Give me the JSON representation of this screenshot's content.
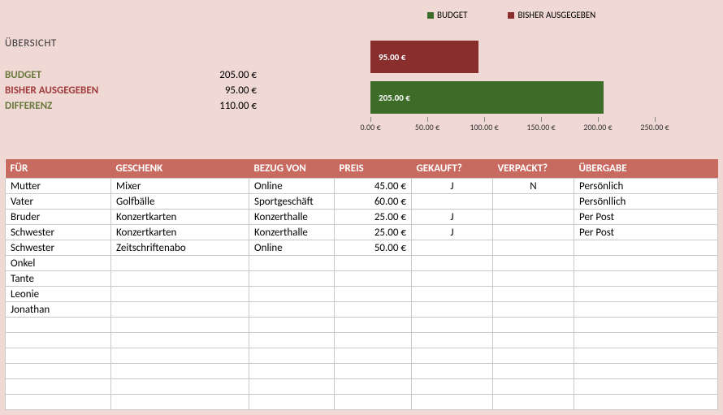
{
  "overview": {
    "title": "ÜBERSICHT",
    "budget_label": "BUDGET",
    "budget_value": "205.00 €",
    "spent_label": "BISHER AUSGEGEBEN",
    "spent_value": "95.00 €",
    "diff_label": "DIFFERENZ",
    "diff_value": "110.00 €"
  },
  "legend": {
    "budget": "BUDGET",
    "spent": "BISHER AUSGEGEBEN"
  },
  "chart_data": {
    "type": "bar",
    "orientation": "horizontal",
    "series": [
      {
        "name": "BISHER AUSGEGEBEN",
        "value": 95.0,
        "label": "95.00 €",
        "color": "#8a2d2d"
      },
      {
        "name": "BUDGET",
        "value": 205.0,
        "label": "205.00 €",
        "color": "#3d6b28"
      }
    ],
    "xlim": [
      0,
      250
    ],
    "xticks": [
      "0.00 €",
      "50.00 €",
      "100.00 €",
      "150.00 €",
      "200.00 €",
      "250.00 €"
    ]
  },
  "table": {
    "headers": {
      "for": "FÜR",
      "gift": "GESCHENK",
      "source": "BEZUG VON",
      "price": "PREIS",
      "bought": "GEKAUFT?",
      "wrapped": "VERPACKT?",
      "delivery": "ÜBERGABE"
    },
    "rows": [
      {
        "for": "Mutter",
        "gift": "Mixer",
        "source": "Online",
        "price": "45.00 €",
        "bought": "J",
        "wrapped": "N",
        "delivery": "Persönlich"
      },
      {
        "for": "Vater",
        "gift": "Golfbälle",
        "source": "Sportgeschäft",
        "price": "60.00 €",
        "bought": "",
        "wrapped": "",
        "delivery": "Persönllich"
      },
      {
        "for": "Bruder",
        "gift": "Konzertkarten",
        "source": "Konzerthalle",
        "price": "25.00 €",
        "bought": "J",
        "wrapped": "",
        "delivery": "Per Post"
      },
      {
        "for": "Schwester",
        "gift": "Konzertkarten",
        "source": "Konzerthalle",
        "price": "25.00 €",
        "bought": "J",
        "wrapped": "",
        "delivery": "Per Post"
      },
      {
        "for": "Schwester",
        "gift": "Zeitschriftenabo",
        "source": "Online",
        "price": "50.00 €",
        "bought": "",
        "wrapped": "",
        "delivery": ""
      },
      {
        "for": "Onkel",
        "gift": "",
        "source": "",
        "price": "",
        "bought": "",
        "wrapped": "",
        "delivery": ""
      },
      {
        "for": "Tante",
        "gift": "",
        "source": "",
        "price": "",
        "bought": "",
        "wrapped": "",
        "delivery": ""
      },
      {
        "for": "Leonie",
        "gift": "",
        "source": "",
        "price": "",
        "bought": "",
        "wrapped": "",
        "delivery": ""
      },
      {
        "for": "Jonathan",
        "gift": "",
        "source": "",
        "price": "",
        "bought": "",
        "wrapped": "",
        "delivery": ""
      },
      {
        "for": "",
        "gift": "",
        "source": "",
        "price": "",
        "bought": "",
        "wrapped": "",
        "delivery": ""
      },
      {
        "for": "",
        "gift": "",
        "source": "",
        "price": "",
        "bought": "",
        "wrapped": "",
        "delivery": ""
      },
      {
        "for": "",
        "gift": "",
        "source": "",
        "price": "",
        "bought": "",
        "wrapped": "",
        "delivery": ""
      },
      {
        "for": "",
        "gift": "",
        "source": "",
        "price": "",
        "bought": "",
        "wrapped": "",
        "delivery": ""
      },
      {
        "for": "",
        "gift": "",
        "source": "",
        "price": "",
        "bought": "",
        "wrapped": "",
        "delivery": ""
      },
      {
        "for": "",
        "gift": "",
        "source": "",
        "price": "",
        "bought": "",
        "wrapped": "",
        "delivery": ""
      }
    ]
  }
}
